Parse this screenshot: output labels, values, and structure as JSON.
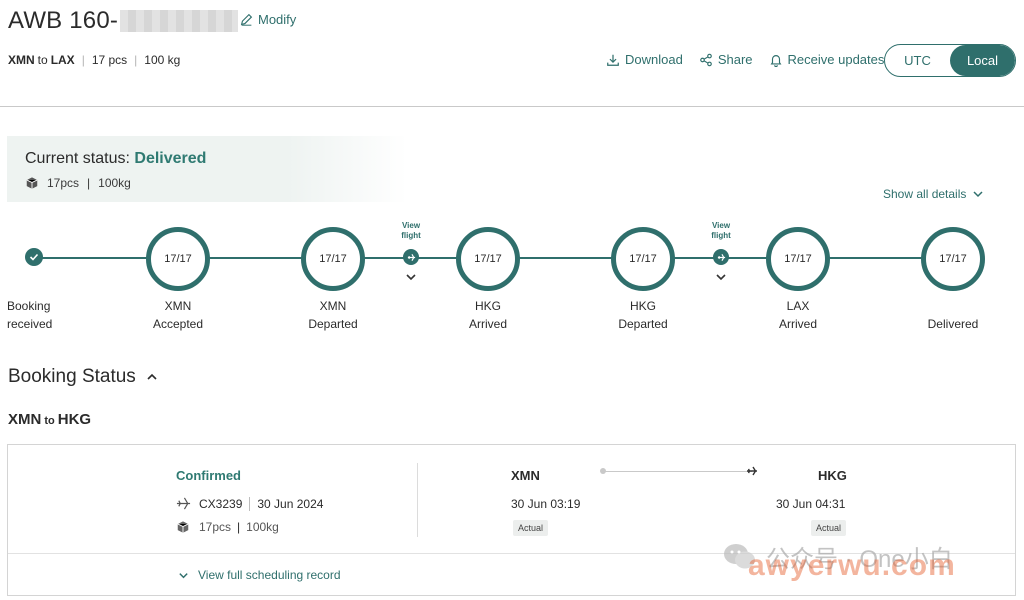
{
  "header": {
    "awb_prefix": "AWB 160-",
    "modify_label": "Modify",
    "origin": "XMN",
    "to_word": "to",
    "destination": "LAX",
    "pieces": "17 pcs",
    "weight": "100 kg"
  },
  "actions": {
    "download_label": "Download",
    "share_label": "Share",
    "updates_label": "Receive updates"
  },
  "timezone": {
    "options": [
      "UTC",
      "Local"
    ],
    "selected": "Local"
  },
  "status": {
    "label": "Current status:",
    "value": "Delivered",
    "pieces": "17pcs",
    "weight": "100kg",
    "show_all": "Show all details"
  },
  "timeline": {
    "start_label_1": "Booking",
    "start_label_2": "received",
    "nodes": [
      {
        "count": "17/17",
        "line1": "XMN",
        "line2": "Accepted"
      },
      {
        "count": "17/17",
        "line1": "XMN",
        "line2": "Departed"
      },
      {
        "count": "17/17",
        "line1": "HKG",
        "line2": "Arrived"
      },
      {
        "count": "17/17",
        "line1": "HKG",
        "line2": "Departed"
      },
      {
        "count": "17/17",
        "line1": "LAX",
        "line2": "Arrived"
      },
      {
        "count": "17/17",
        "line1": "",
        "line2": "Delivered"
      }
    ],
    "view_flight_1": "View",
    "view_flight_2": "flight"
  },
  "booking": {
    "title": "Booking Status",
    "segment_origin": "XMN",
    "segment_to": "to",
    "segment_destination": "HKG",
    "status": "Confirmed",
    "flight": "CX3239",
    "date": "30 Jun 2024",
    "pieces": "17pcs",
    "weight": "100kg",
    "origin": "XMN",
    "destination": "HKG",
    "origin_time": "30 Jun 03:19",
    "destination_time": "30 Jun 04:31",
    "origin_badge": "Actual",
    "destination_badge": "Actual",
    "view_schedule": "View full scheduling record"
  },
  "watermark": {
    "text1": "公众号 · One小白",
    "text2": "awyerwu.com"
  },
  "colors": {
    "accent": "#2f6f6c",
    "status_green": "#2f7a72",
    "status_bg": "#eef3f1"
  }
}
